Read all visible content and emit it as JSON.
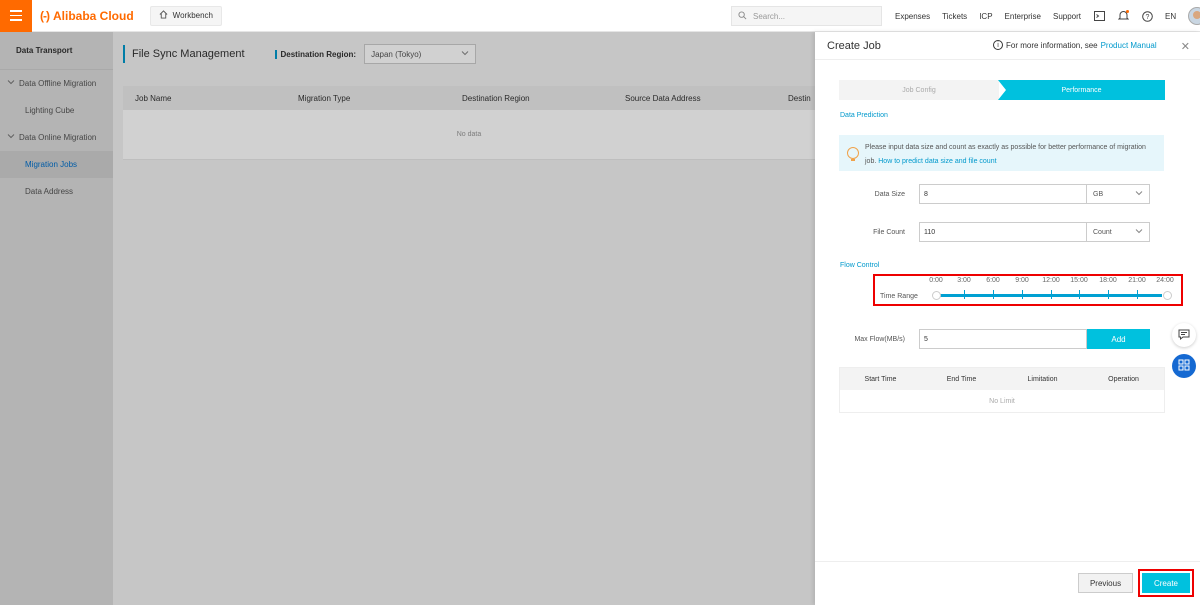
{
  "topbar": {
    "brand": "Alibaba Cloud",
    "brand_mark": "(-)",
    "workbench": "Workbench",
    "search_placeholder": "Search...",
    "nav": [
      "Expenses",
      "Tickets",
      "ICP",
      "Enterprise",
      "Support"
    ],
    "language": "EN",
    "accent_color": "#ff6a00"
  },
  "sidebar": {
    "title": "Data Transport",
    "groups": [
      {
        "label": "Data Offline Migration",
        "items": [
          "Lighting Cube"
        ]
      },
      {
        "label": "Data Online Migration",
        "items": [
          "Migration Jobs",
          "Data Address"
        ]
      }
    ]
  },
  "main": {
    "title": "File Sync Management",
    "region_label": "Destination Region:",
    "region_value": "Japan (Tokyo)",
    "columns": [
      "Job Name",
      "Migration Type",
      "Destination Region",
      "Source Data Address",
      "Destin"
    ],
    "empty_text": "No data"
  },
  "drawer": {
    "title": "Create Job",
    "info_text": "For more information, see",
    "info_link": "Product Manual",
    "steps": [
      "Job Config",
      "Performance"
    ],
    "data_prediction_label": "Data Prediction",
    "tip_text": "Please input data size and count as exactly as possible for better performance of migration job.",
    "tip_link": "How to predict data size and file count",
    "data_size_label": "Data Size",
    "data_size_value": "8",
    "data_size_unit": "GB",
    "file_count_label": "File Count",
    "file_count_value": "110",
    "file_count_unit": "Count",
    "flow_control_label": "Flow Control",
    "time_range_label": "Time Range",
    "time_ticks": [
      "0:00",
      "3:00",
      "6:00",
      "9:00",
      "12:00",
      "15:00",
      "18:00",
      "21:00",
      "24:00"
    ],
    "max_flow_label": "Max Flow(MB/s)",
    "max_flow_value": "5",
    "add_label": "Add",
    "limit_columns": [
      "Start Time",
      "End Time",
      "Limitation",
      "Operation"
    ],
    "limit_empty": "No Limit",
    "previous_label": "Previous",
    "create_label": "Create",
    "accent_color": "#00c1de"
  }
}
